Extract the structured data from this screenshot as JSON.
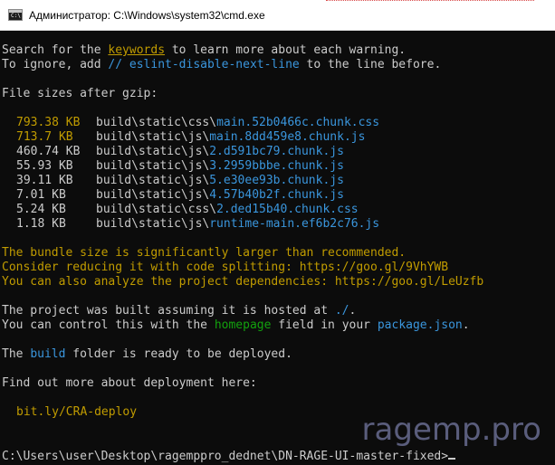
{
  "window": {
    "title": "Администратор: C:\\Windows\\system32\\cmd.exe",
    "icon_label": "C:\\"
  },
  "console": {
    "l1": {
      "a": "Search for the ",
      "b": "keywords",
      "c": " to learn more about each warning."
    },
    "l2": {
      "a": "To ignore, add ",
      "b": "// eslint-disable-next-line",
      "c": " to the line before."
    },
    "l3": "File sizes after gzip:",
    "files": [
      {
        "size": "793.38 KB",
        "dir": "build\\static\\css\\",
        "name": "main.52b0466c.chunk.css",
        "size_color": "y"
      },
      {
        "size": "713.7 KB",
        "dir": "build\\static\\js\\",
        "name": "main.8dd459e8.chunk.js",
        "size_color": "y"
      },
      {
        "size": "460.74 KB",
        "dir": "build\\static\\js\\",
        "name": "2.d591bc79.chunk.js",
        "size_color": "w"
      },
      {
        "size": "55.93 KB",
        "dir": "build\\static\\js\\",
        "name": "3.2959bbbe.chunk.js",
        "size_color": "w"
      },
      {
        "size": "39.11 KB",
        "dir": "build\\static\\js\\",
        "name": "5.e30ee93b.chunk.js",
        "size_color": "w"
      },
      {
        "size": "7.01 KB",
        "dir": "build\\static\\js\\",
        "name": "4.57b40b2f.chunk.js",
        "size_color": "w"
      },
      {
        "size": "5.24 KB",
        "dir": "build\\static\\css\\",
        "name": "2.ded15b40.chunk.css",
        "size_color": "w"
      },
      {
        "size": "1.18 KB",
        "dir": "build\\static\\js\\",
        "name": "runtime-main.ef6b2c76.js",
        "size_color": "w"
      }
    ],
    "warn1": "The bundle size is significantly larger than recommended.",
    "warn2": "Consider reducing it with code splitting: https://goo.gl/9VhYWB",
    "warn3": "You can also analyze the project dependencies: https://goo.gl/LeUzfb",
    "hosted": {
      "a": "The project was built assuming it is hosted at ",
      "b": "./",
      "c": "."
    },
    "control": {
      "a": "You can control this with the ",
      "b": "homepage",
      "c": " field in your ",
      "d": "package.json",
      "e": "."
    },
    "build": {
      "a": "The ",
      "b": "build",
      "c": " folder is ready to be deployed."
    },
    "findout": "Find out more about deployment here:",
    "link": "bit.ly/CRA-deploy",
    "prompt": "C:\\Users\\user\\Desktop\\ragemppro_dednet\\DN-RAGE-UI-master-fixed>"
  },
  "watermark": "ragemp.pro",
  "colors": {
    "background": "#0c0c0c",
    "text": "#cccccc",
    "yellow": "#c19c00",
    "blue": "#3a96dd",
    "green": "#13a10e"
  }
}
